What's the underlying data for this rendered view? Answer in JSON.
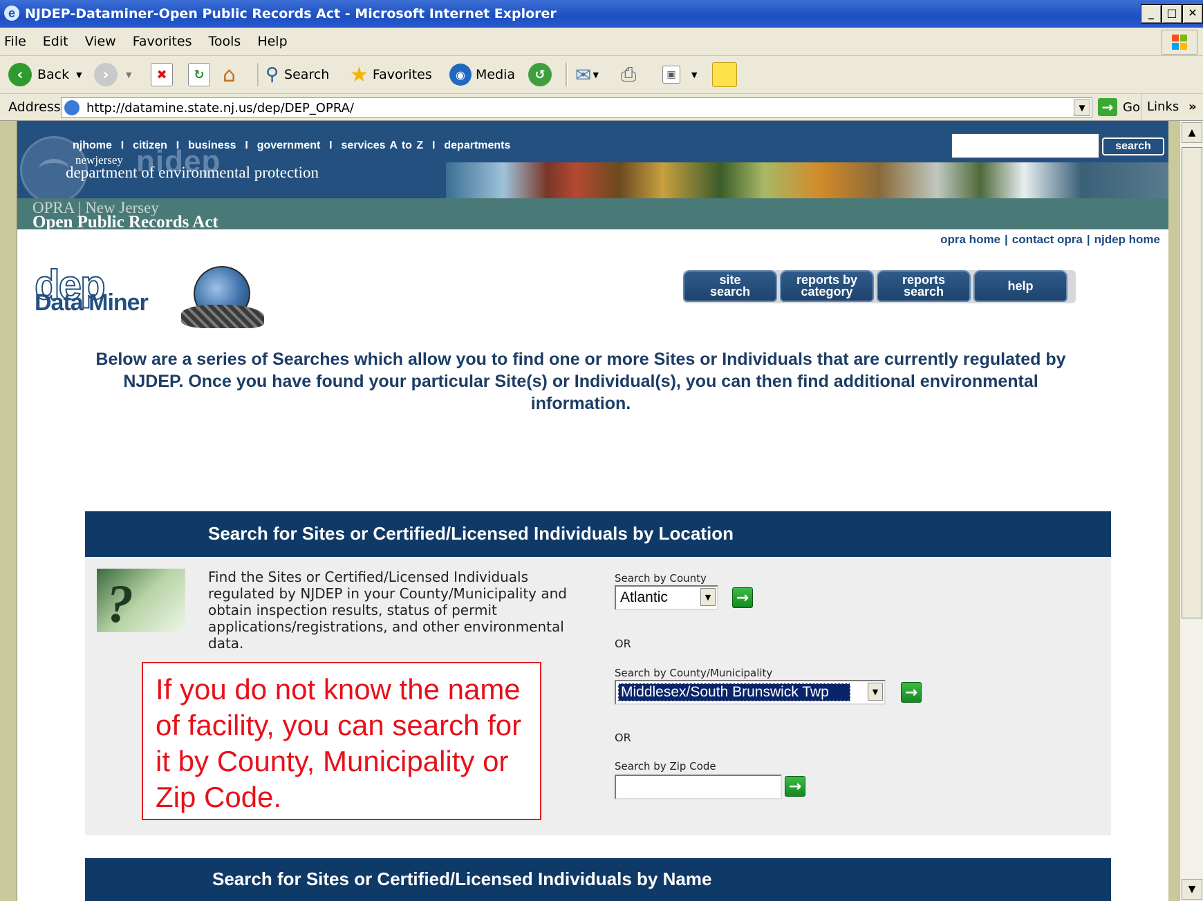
{
  "window": {
    "title": "NJDEP-Dataminer-Open Public Records Act - Microsoft Internet Explorer",
    "controls": [
      "_",
      "□",
      "✕"
    ]
  },
  "menu": [
    "File",
    "Edit",
    "View",
    "Favorites",
    "Tools",
    "Help"
  ],
  "toolbar": {
    "back": "Back",
    "search": "Search",
    "favorites": "Favorites",
    "media": "Media"
  },
  "address": {
    "label": "Address",
    "url": "http://datamine.state.nj.us/dep/DEP_OPRA/",
    "go": "Go",
    "links": "Links",
    "links_more": "»"
  },
  "njheader": {
    "nav": "njhome  I  citizen  I  business  I  government  I  services A to Z  I  departments",
    "search_button": "search",
    "newjersey": "newjersey",
    "nidep": "nidep",
    "department": "department of environmental protection",
    "opra_line1": "OPRA | New Jersey",
    "opra_line2": "Open Public Records Act"
  },
  "toplinks": [
    "opra home",
    "contact opra",
    "njdep home"
  ],
  "logo": {
    "dep": "dep",
    "dataminer": "Data Miner"
  },
  "navbuttons": [
    "site\nsearch",
    "reports by\ncategory",
    "reports\nsearch",
    "help"
  ],
  "intro": "Below are a series of Searches which allow you to find one or more Sites or Individuals that are currently regulated by NJDEP. Once you have found your particular Site(s) or Individual(s), you can then find additional environmental information.",
  "location_section": {
    "heading": "Search for Sites or Certified/Licensed Individuals by Location",
    "description": "Find the Sites or Certified/Licensed Individuals regulated by NJDEP in your County/Municipality and obtain inspection results, status of permit applications/registrations, and other environmental data.",
    "county_label": "Search by County",
    "county_value": "Atlantic",
    "or1": "OR",
    "muni_label": "Search by County/Municipality",
    "muni_value": "Middlesex/South Brunswick Twp",
    "or2": "OR",
    "zip_label": "Search by Zip Code",
    "zip_value": ""
  },
  "callout": "If you do not know the name of facility, you can search for it by County, Municipality or Zip Code.",
  "name_section": {
    "heading": "Search for Sites or Certified/Licensed Individuals by Name"
  },
  "colors": {
    "accent_navy": "#0f3967",
    "callout_red": "#e8101a"
  }
}
